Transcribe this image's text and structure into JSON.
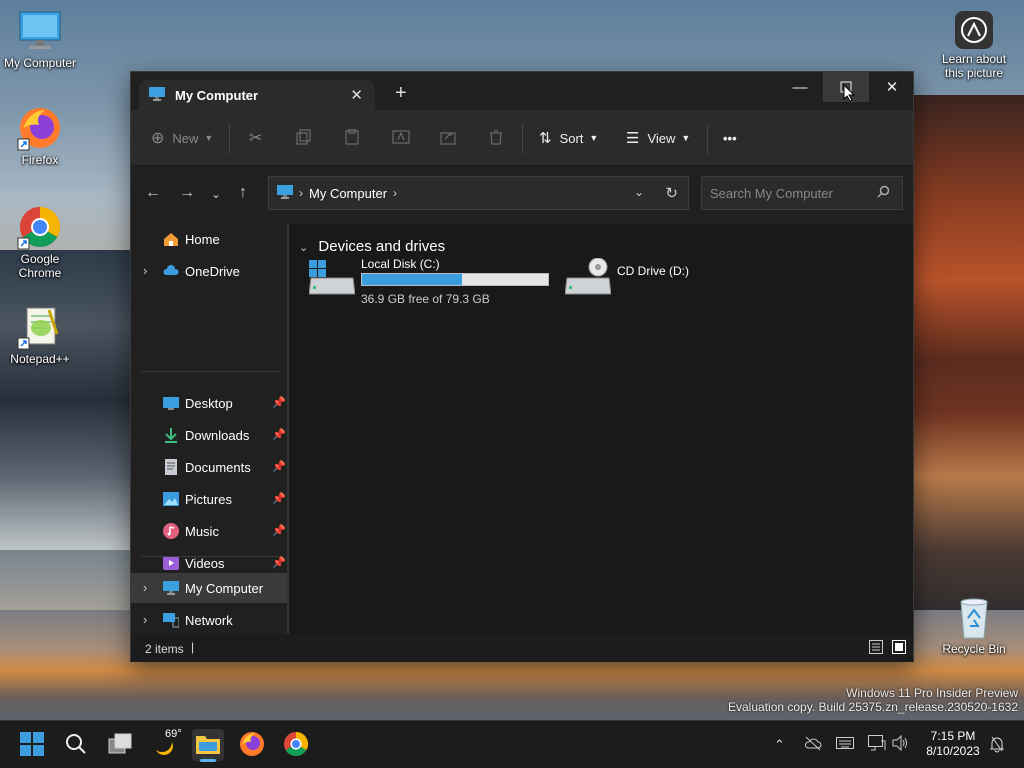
{
  "desktop": {
    "icons": [
      {
        "label": "My Computer"
      },
      {
        "label": "Firefox"
      },
      {
        "label": "Google Chrome"
      },
      {
        "label": "Notepad++"
      }
    ],
    "learn_about": "Learn about this picture",
    "recycle_bin": "Recycle Bin",
    "watermark_line1": "Windows 11 Pro Insider Preview",
    "watermark_line2": "Evaluation copy. Build 25375.zn_release.230520-1632"
  },
  "window": {
    "tab_title": "My Computer",
    "toolbar": {
      "new_label": "New",
      "sort_label": "Sort",
      "view_label": "View",
      "more_label": "•••"
    },
    "address": {
      "crumb": "My Computer"
    },
    "search_placeholder": "Search My Computer",
    "sidebar": {
      "home": "Home",
      "onedrive": "OneDrive",
      "desktop": "Desktop",
      "downloads": "Downloads",
      "documents": "Documents",
      "pictures": "Pictures",
      "music": "Music",
      "videos": "Videos",
      "share": "share",
      "my_computer": "My Computer",
      "network": "Network"
    },
    "section_title": "Devices and drives",
    "drives": [
      {
        "name": "Local Disk (C:)",
        "free_text": "36.9 GB free of 79.3 GB",
        "used_fraction": 0.535
      },
      {
        "name": "CD Drive (D:)"
      }
    ],
    "status_text": "2 items"
  },
  "taskbar": {
    "weather_temp": "69°",
    "time": "7:15 PM",
    "date": "8/10/2023"
  },
  "colors": {
    "accent": "#3b9ddd",
    "window_bg": "#191919",
    "toolbar_bg": "#2b2b2b"
  }
}
